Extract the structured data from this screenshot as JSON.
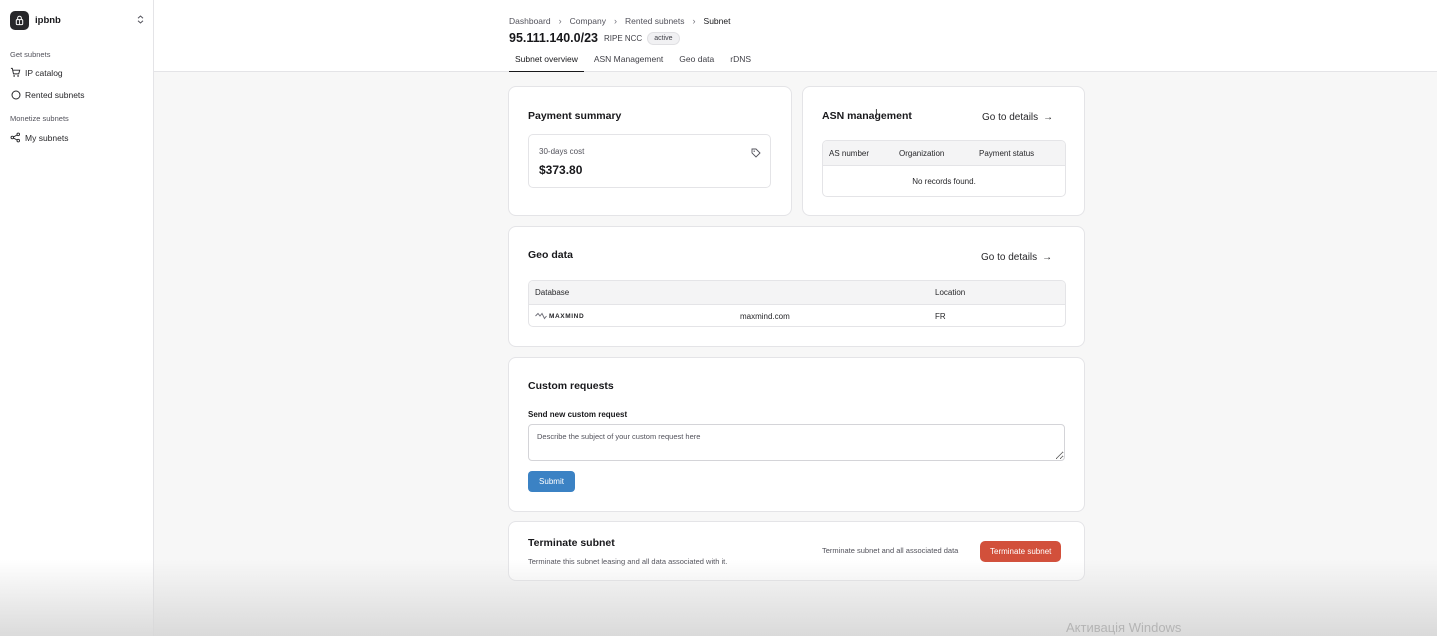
{
  "brand": {
    "name": "ipbnb",
    "switch_icon": "chevron-up-down-icon"
  },
  "sidebar": {
    "groups": [
      {
        "label": "Get subnets",
        "items": [
          {
            "label": "IP catalog",
            "icon": "cart-icon"
          },
          {
            "label": "Rented subnets",
            "icon": "circle-icon"
          }
        ]
      },
      {
        "label": "Monetize subnets",
        "items": [
          {
            "label": "My subnets",
            "icon": "share-icon"
          }
        ]
      }
    ]
  },
  "breadcrumb": [
    "Dashboard",
    "Company",
    "Rented subnets",
    "Subnet"
  ],
  "subnet": {
    "title": "95.111.140.0/23",
    "registry": "RIPE NCC",
    "status": "active"
  },
  "tabs": [
    "Subnet overview",
    "ASN Management",
    "Geo data",
    "rDNS"
  ],
  "payment": {
    "title": "Payment summary",
    "cost_label": "30-days cost",
    "cost_value": "$373.80"
  },
  "asn": {
    "title": "ASN management",
    "go_details": "Go to details",
    "columns": [
      "AS number",
      "Organization",
      "Payment status"
    ],
    "empty": "No records found."
  },
  "geo": {
    "title": "Geo data",
    "go_details": "Go to details",
    "columns": [
      "Database",
      "Location"
    ],
    "rows": [
      {
        "logo": "MAXMIND",
        "database": "maxmind.com",
        "location": "FR"
      }
    ]
  },
  "custom": {
    "title": "Custom requests",
    "field_label": "Send new custom request",
    "placeholder": "Describe the subject of your custom request here",
    "submit": "Submit"
  },
  "terminate": {
    "title": "Terminate subnet",
    "description": "Terminate this subnet leasing and all data associated with it.",
    "hint": "Terminate subnet and all associated data",
    "button": "Terminate subnet"
  },
  "watermark": "Активація Windows",
  "colors": {
    "primary": "#3b82c4",
    "danger": "#d2503b",
    "background": "#f7f7f7"
  }
}
